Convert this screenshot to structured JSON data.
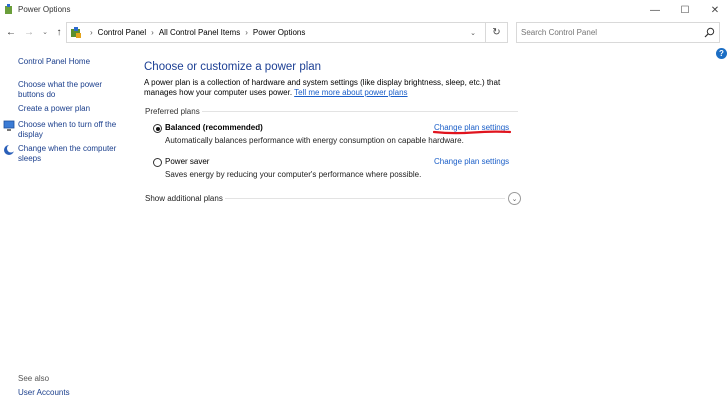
{
  "window": {
    "title": "Power Options",
    "minimize_glyph": "—",
    "maximize_glyph": "☐",
    "close_glyph": "✕"
  },
  "nav": {
    "back_glyph": "←",
    "forward_glyph": "→",
    "recent_glyph": "⌄",
    "up_glyph": "↑"
  },
  "address": {
    "separator": "›",
    "crumbs": [
      "Control Panel",
      "All Control Panel Items",
      "Power Options"
    ],
    "dropdown_glyph": "⌄",
    "refresh_glyph": "↻"
  },
  "search": {
    "placeholder": "Search Control Panel"
  },
  "help": {
    "glyph": "?"
  },
  "sidebar": {
    "home": "Control Panel Home",
    "items": [
      "Choose what the power buttons do",
      "Create a power plan",
      "Choose when to turn off the display",
      "Change when the computer sleeps"
    ],
    "see_also_label": "See also",
    "see_also_items": [
      "User Accounts"
    ]
  },
  "main": {
    "heading": "Choose or customize a power plan",
    "intro_text": "A power plan is a collection of hardware and system settings (like display brightness, sleep, etc.) that manages how your computer uses power. ",
    "intro_link": "Tell me more about power plans",
    "section_label": "Preferred plans",
    "plans": [
      {
        "name": "Balanced (recommended)",
        "selected": true,
        "description": "Automatically balances performance with energy consumption on capable hardware.",
        "link": "Change plan settings"
      },
      {
        "name": "Power saver",
        "selected": false,
        "description": "Saves energy by reducing your computer's performance where possible.",
        "link": "Change plan settings"
      }
    ],
    "additional_plans_label": "Show additional plans",
    "expand_glyph": "⌄"
  },
  "colors": {
    "heading": "#1c3f94",
    "link": "#1a5ec8",
    "annotation": "#e0141e"
  },
  "icons": {
    "app": "power-options-icon",
    "address": "control-panel-icon",
    "search": "search-icon",
    "help": "help-icon"
  }
}
